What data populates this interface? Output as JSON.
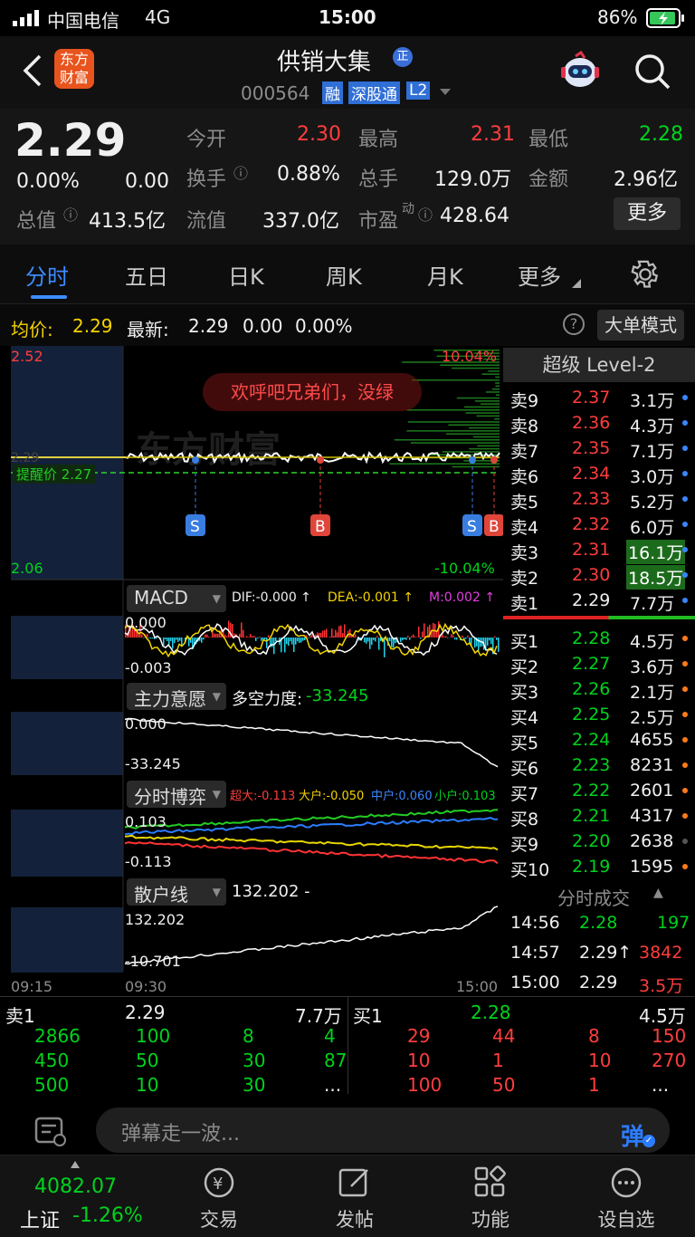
{
  "status": {
    "carrier": "中国电信",
    "network": "4G",
    "time": "15:00",
    "battery": "86%"
  },
  "header": {
    "logo_line1": "东方",
    "logo_line2": "财富",
    "stock_name": "供销大集",
    "badge": "正",
    "code": "000564",
    "tags": [
      "融",
      "深股通",
      "L2"
    ]
  },
  "quote": {
    "price": "2.29",
    "pct": "0.00%",
    "change": "0.00",
    "open_label": "今开",
    "open": "2.30",
    "high_label": "最高",
    "high": "2.31",
    "low_label": "最低",
    "low": "2.28",
    "turnover_label": "换手",
    "turnover": "0.88%",
    "vol_label": "总手",
    "vol": "129.0万",
    "amount_label": "金额",
    "amount": "2.96亿",
    "mcap_label": "总值",
    "mcap": "413.5亿",
    "float_label": "流值",
    "float": "337.0亿",
    "pe_label": "市盈",
    "pe_sup": "动",
    "pe": "428.64",
    "more": "更多"
  },
  "tabs": [
    "分时",
    "五日",
    "日K",
    "周K",
    "月K",
    "更多"
  ],
  "avg": {
    "label": "均价:",
    "value": "2.29",
    "latest_label": "最新:",
    "latest": "2.29",
    "chg": "0.00",
    "pct": "0.00%",
    "mode": "大单模式"
  },
  "chart": {
    "top": "2.52",
    "bottom": "2.06",
    "up_pct": "10.04%",
    "down_pct": "-10.04%",
    "mid": "2.29",
    "alert": "提醒价 2.27",
    "danmu": "欢呼吧兄弟们，没绿",
    "watermark": "东方财富",
    "markers": [
      "S",
      "B",
      "S",
      "B"
    ],
    "macd": {
      "name": "MACD",
      "dif": "DIF:-0.000 ↑",
      "dea": "DEA:-0.001 ↑",
      "m": "M:0.002 ↑",
      "top": "0.000",
      "bottom": "-0.003"
    },
    "zlyy": {
      "name": "主力意愿",
      "label": "多空力度:",
      "value": "-33.245",
      "top": "0.000",
      "bottom": "-33.245"
    },
    "fsby": {
      "name": "分时博弈",
      "cd": "超大:-0.113",
      "dh": "大户:-0.050",
      "zh": "中户:0.060",
      "xh": "小户:0.103",
      "top": "0.103",
      "bottom": "-0.113"
    },
    "shx": {
      "name": "散户线",
      "value": "132.202 -",
      "top": "132.202",
      "bottom": "-10.701"
    },
    "times": [
      "09:15",
      "09:30",
      "15:00"
    ]
  },
  "orderbook": {
    "title": "超级 Level-2",
    "asks": [
      [
        "卖9",
        "2.37",
        "3.1万"
      ],
      [
        "卖8",
        "2.36",
        "4.3万"
      ],
      [
        "卖7",
        "2.35",
        "7.1万"
      ],
      [
        "卖6",
        "2.34",
        "3.0万"
      ],
      [
        "卖5",
        "2.33",
        "5.2万"
      ],
      [
        "卖4",
        "2.32",
        "6.0万"
      ],
      [
        "卖3",
        "2.31",
        "16.1万"
      ],
      [
        "卖2",
        "2.30",
        "18.5万"
      ],
      [
        "卖1",
        "2.29",
        "7.7万"
      ]
    ],
    "bids": [
      [
        "买1",
        "2.28",
        "4.5万"
      ],
      [
        "买2",
        "2.27",
        "3.6万"
      ],
      [
        "买3",
        "2.26",
        "2.1万"
      ],
      [
        "买4",
        "2.25",
        "2.5万"
      ],
      [
        "买5",
        "2.24",
        "4655"
      ],
      [
        "买6",
        "2.23",
        "8231"
      ],
      [
        "买7",
        "2.22",
        "2601"
      ],
      [
        "买8",
        "2.21",
        "4317"
      ],
      [
        "买9",
        "2.20",
        "2638"
      ],
      [
        "买10",
        "2.19",
        "1595"
      ]
    ],
    "trades_title": "分时成交",
    "trades": [
      [
        "14:56",
        "2.28",
        "197"
      ],
      [
        "14:57",
        "2.29↑",
        "3842"
      ],
      [
        "15:00",
        "2.29",
        "3.5万"
      ]
    ]
  },
  "queue": {
    "sell_label": "卖1",
    "sell_price": "2.29",
    "sell_vol": "7.7万",
    "buy_label": "买1",
    "buy_price": "2.28",
    "buy_vol": "4.5万",
    "sell_rows": [
      [
        "2866",
        "100",
        "8",
        "4"
      ],
      [
        "450",
        "50",
        "30",
        "87"
      ],
      [
        "500",
        "10",
        "30",
        "..."
      ]
    ],
    "buy_rows": [
      [
        "29",
        "44",
        "8",
        "150"
      ],
      [
        "10",
        "1",
        "10",
        "270"
      ],
      [
        "100",
        "50",
        "1",
        "..."
      ]
    ]
  },
  "danmu_input": {
    "placeholder": "弹幕走一波...",
    "btn": "弹"
  },
  "nav": {
    "index_value": "4082.07",
    "index_name": "上证",
    "index_pct": "-1.26%",
    "items": [
      "交易",
      "发帖",
      "功能",
      "设自选"
    ]
  }
}
